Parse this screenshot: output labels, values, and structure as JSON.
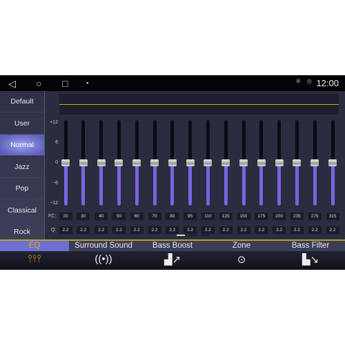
{
  "status": {
    "time": "12:00",
    "icons": [
      "back-icon",
      "home-icon",
      "recents-icon",
      "gallery-icon",
      "bluetooth-icon",
      "location-icon"
    ]
  },
  "presets": [
    {
      "label": "Default"
    },
    {
      "label": "User"
    },
    {
      "label": "Normal",
      "selected": true
    },
    {
      "label": "Jazz"
    },
    {
      "label": "Pop"
    },
    {
      "label": "Classical"
    },
    {
      "label": "Rock"
    }
  ],
  "eq": {
    "scale": [
      "+12",
      "6",
      "0",
      "−6",
      "−12"
    ],
    "fc_label": "FC:",
    "q_label": "Q:",
    "bands": [
      {
        "fc": "20",
        "q": "2.2",
        "gain": 0
      },
      {
        "fc": "30",
        "q": "2.2",
        "gain": 0
      },
      {
        "fc": "40",
        "q": "2.2",
        "gain": 0
      },
      {
        "fc": "50",
        "q": "2.2",
        "gain": 0
      },
      {
        "fc": "60",
        "q": "2.2",
        "gain": 0
      },
      {
        "fc": "70",
        "q": "2.2",
        "gain": 0
      },
      {
        "fc": "80",
        "q": "2.2",
        "gain": 0
      },
      {
        "fc": "95",
        "q": "2.2",
        "gain": 0
      },
      {
        "fc": "110",
        "q": "2.2",
        "gain": 0
      },
      {
        "fc": "125",
        "q": "2.2",
        "gain": 0
      },
      {
        "fc": "150",
        "q": "2.2",
        "gain": 0
      },
      {
        "fc": "175",
        "q": "2.2",
        "gain": 0
      },
      {
        "fc": "200",
        "q": "2.2",
        "gain": 0
      },
      {
        "fc": "235",
        "q": "2.2",
        "gain": 0
      },
      {
        "fc": "275",
        "q": "2.2",
        "gain": 0
      },
      {
        "fc": "315",
        "q": "2.2",
        "gain": 0
      }
    ],
    "page": 1,
    "pages": 3,
    "curve_color": "#b8b020",
    "fill_color": "#7b63e0"
  },
  "tabs": [
    {
      "label": "EQ",
      "icon": "equalizer-icon",
      "selected": true
    },
    {
      "label": "Surround Sound",
      "icon": "surround-icon"
    },
    {
      "label": "Bass Boost",
      "icon": "bass-boost-icon"
    },
    {
      "label": "Zone",
      "icon": "zone-icon"
    },
    {
      "label": "Bass Filter",
      "icon": "bass-filter-icon"
    }
  ],
  "accent": "#f0a020"
}
